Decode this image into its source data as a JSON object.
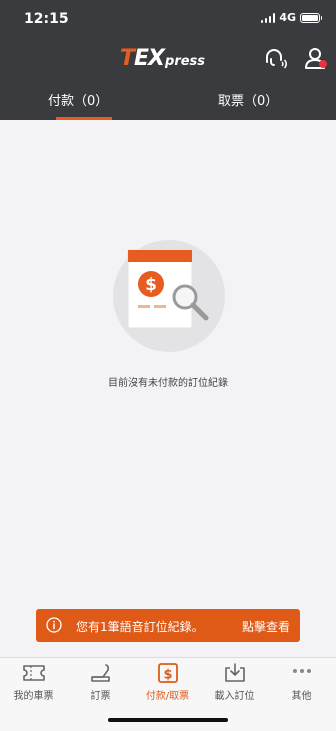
{
  "status": {
    "time": "12:15",
    "network": "4G"
  },
  "header": {
    "logo_t": "T",
    "logo_ex": "EX",
    "logo_press": "press"
  },
  "tabs": [
    {
      "label": "付款（0）"
    },
    {
      "label": "取票（0）"
    }
  ],
  "empty": {
    "message": "目前沒有未付款的訂位紀錄"
  },
  "toast": {
    "message": "您有1筆語音訂位紀錄。",
    "action": "點擊查看"
  },
  "nav": [
    {
      "label": "我的車票",
      "icon": "ticket-icon"
    },
    {
      "label": "訂票",
      "icon": "seat-icon"
    },
    {
      "label": "付款/取票",
      "icon": "payment-icon",
      "active": true
    },
    {
      "label": "載入訂位",
      "icon": "download-icon"
    },
    {
      "label": "其他",
      "icon": "more-icon"
    }
  ],
  "colors": {
    "accent": "#e85d1f",
    "header_bg": "#3a3b3f",
    "page_bg": "#f3f3f5"
  }
}
